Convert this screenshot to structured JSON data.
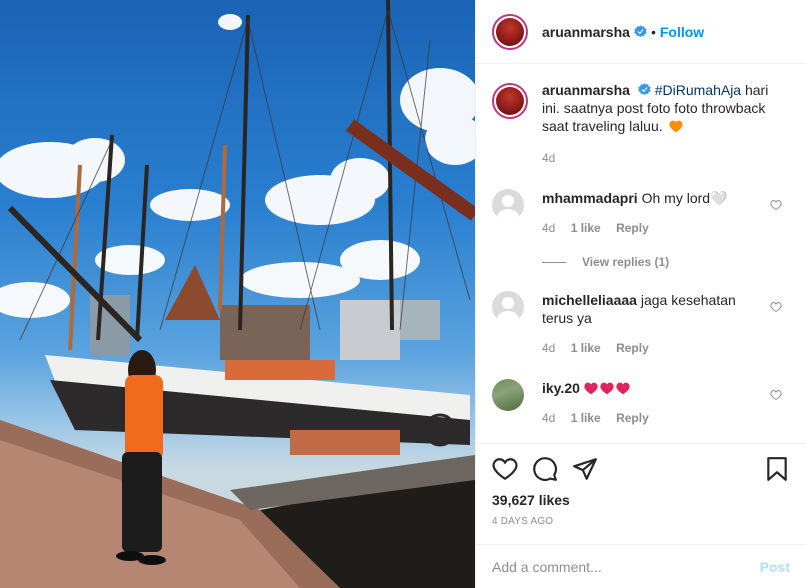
{
  "post": {
    "username": "aruanmarsha",
    "follow_label": "Follow",
    "separator": "•"
  },
  "caption": {
    "username": "aruanmarsha",
    "hashtag": "#DiRumahAja",
    "text": " hari ini. saatnya post foto foto throwback saat traveling laluu.",
    "emoji": "orange-heart",
    "age": "4d"
  },
  "comments": [
    {
      "username": "mhammadapri",
      "text": "Oh my lord🤍",
      "age": "4d",
      "likes": "1 like",
      "reply_label": "Reply",
      "avatar": "default-avatar-icon"
    },
    {
      "username": "michelleliaaaa",
      "text": "jaga kesehatan terus ya",
      "age": "4d",
      "likes": "1 like",
      "reply_label": "Reply",
      "avatar": "default-avatar-icon"
    },
    {
      "username": "iky.20",
      "text": "",
      "emojis": [
        "red-heart",
        "red-heart",
        "red-heart"
      ],
      "age": "4d",
      "likes": "1 like",
      "reply_label": "Reply",
      "avatar": "photo-avatar"
    }
  ],
  "view_replies": "View replies (1)",
  "actions": {
    "icons": [
      "heart-icon",
      "comment-icon",
      "share-icon",
      "bookmark-icon"
    ],
    "likes": "39,627 likes",
    "date": "4 DAYS AGO"
  },
  "add_comment": {
    "placeholder": "Add a comment...",
    "post_label": "Post"
  },
  "colors": {
    "accent": "#0095f6",
    "verified": "#3897f0",
    "muted": "#8e8e8e",
    "text": "#262626",
    "post_disabled": "#b2dffc"
  }
}
